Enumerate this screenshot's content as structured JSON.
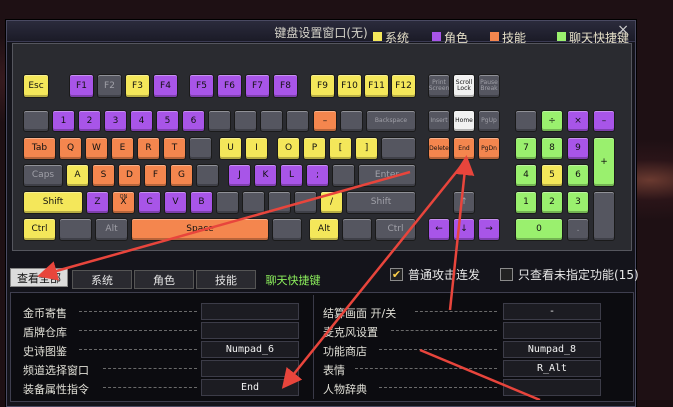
{
  "window": {
    "title": "键盘设置窗口(无)",
    "close_label": "×"
  },
  "legend": [
    {
      "label": "系统",
      "color": "#f4e75a"
    },
    {
      "label": "角色",
      "color": "#a855e8"
    },
    {
      "label": "技能",
      "color": "#f4864e"
    },
    {
      "label": "聊天快捷键",
      "color": "#9af06e"
    }
  ],
  "keys": {
    "esc": "Esc",
    "f1": "F1",
    "f2": "F2",
    "f3": "F3",
    "f4": "F4",
    "f5": "F5",
    "f6": "F6",
    "f7": "F7",
    "f8": "F8",
    "f9": "F9",
    "f10": "F10",
    "f11": "F11",
    "f12": "F12",
    "prtsc": "Print Screen",
    "scroll": "Scroll Lock",
    "pause": "Pause Break",
    "d1": "1",
    "d2": "2",
    "d3": "3",
    "d4": "4",
    "d5": "5",
    "d6": "6",
    "minus": "–",
    "backspace": "Backspace",
    "insert": "Insert",
    "home": "Home",
    "pgup": "PgUp",
    "np_div": "÷",
    "np_mul": "×",
    "np_minus": "–",
    "tab": "Tab",
    "q": "Q",
    "w": "W",
    "e": "E",
    "r": "R",
    "t": "T",
    "u": "U",
    "i": "I",
    "o": "O",
    "p": "P",
    "lbr": "[",
    "rbr": "]",
    "delete": "Delete",
    "end": "End",
    "pgdn": "PgDn",
    "np7": "7",
    "np8": "8",
    "np9": "9",
    "np_plus": "+",
    "caps": "Caps",
    "a": "A",
    "s": "S",
    "d": "D",
    "f": "F",
    "g": "G",
    "j": "J",
    "k": "K",
    "l": "L",
    "semi": ";",
    "enter": "Enter",
    "np4": "4",
    "np5": "5",
    "np6": "6",
    "shift": "Shift",
    "z": "Z",
    "x": "X",
    "x_sub": "ON",
    "c": "C",
    "v": "V",
    "b": "B",
    "slash": "/",
    "rshift": "Shift",
    "np1": "1",
    "np2": "2",
    "np3": "3",
    "ctrl": "Ctrl",
    "alt": "Alt",
    "space": "Space",
    "ralt": "Alt",
    "rctrl": "Ctrl",
    "left": "←",
    "down": "↓",
    "right": "→",
    "up": "↑",
    "np0": "0",
    "np_dot": "."
  },
  "tabs": {
    "all": "查看全部",
    "system": "系统",
    "role": "角色",
    "skill": "技能",
    "chat": "聊天快捷键"
  },
  "options": {
    "normal_attack": "普通攻击连发",
    "normal_attack_checked": "✔",
    "unassigned_only": "只查看未指定功能(15)"
  },
  "list_left": [
    {
      "label": "金币寄售",
      "value": ""
    },
    {
      "label": "盾牌仓库",
      "value": ""
    },
    {
      "label": "史诗图鉴",
      "value": "Numpad_6"
    },
    {
      "label": "频道选择窗口",
      "value": ""
    },
    {
      "label": "装备属性指令",
      "value": "End"
    }
  ],
  "list_right": [
    {
      "label": "结算画面 开/关",
      "value": "-"
    },
    {
      "label": "麦克风设置",
      "value": ""
    },
    {
      "label": "功能商店",
      "value": "Numpad_8"
    },
    {
      "label": "表情",
      "value": "R_Alt"
    },
    {
      "label": "人物辞典",
      "value": ""
    }
  ]
}
